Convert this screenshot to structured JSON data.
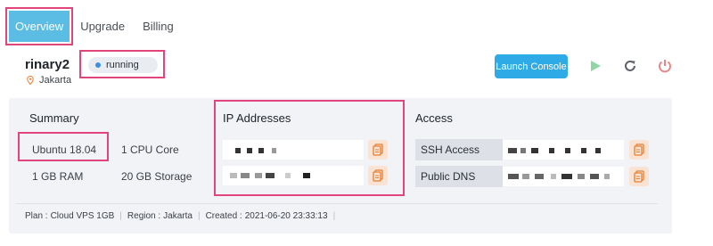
{
  "tabs": [
    {
      "label": "Overview"
    },
    {
      "label": "Upgrade"
    },
    {
      "label": "Billing"
    }
  ],
  "server": {
    "name": "rinary2",
    "location": "Jakarta",
    "status": "running"
  },
  "actions": {
    "launch_console": "Launch Console",
    "start_icon": "play-icon",
    "restart_icon": "restart-icon",
    "power_icon": "power-icon"
  },
  "summary": {
    "title": "Summary",
    "os": "Ubuntu 18.04",
    "cpu": "1 CPU Core",
    "ram": "1 GB RAM",
    "storage": "20 GB Storage"
  },
  "ip": {
    "title": "IP Addresses"
  },
  "access": {
    "title": "Access",
    "ssh_label": "SSH Access",
    "dns_label": "Public DNS"
  },
  "footer": {
    "plan_label": "Plan :",
    "plan_value": "Cloud VPS 1GB",
    "region_label": "Region :",
    "region_value": "Jakarta",
    "created_label": "Created :",
    "created_value": "2021-06-20 23:33:13"
  },
  "colors": {
    "accent": "#2eabe6",
    "highlight": "#e0457b",
    "play": "#8fd6a4",
    "power": "#e98585",
    "copy": "#e57e33"
  }
}
